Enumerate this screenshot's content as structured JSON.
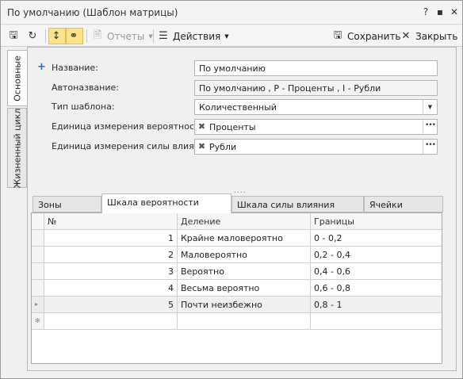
{
  "window": {
    "title": "По умолчанию (Шаблон матрицы)",
    "help_glyph": "?",
    "restore_glyph": "▪",
    "close_glyph": "✕"
  },
  "toolbar": {
    "reports_label": "Отчеты",
    "actions_label": "Действия",
    "save_label": "Сохранить",
    "close_label": "Закрыть",
    "icons": {
      "save": "🖫",
      "refresh": "↻",
      "sort": "↕",
      "link": "⚭",
      "reports": "🗎",
      "actions": "☰",
      "close": "✕"
    }
  },
  "side_tabs": {
    "main": "Основные",
    "lifecycle": "Жизненный цикл"
  },
  "form": {
    "name_label": "Название:",
    "name_value": "По умолчанию",
    "autoname_label": "Автоназвание:",
    "autoname_value": "По умолчанию , P - Проценты , I - Рубли",
    "template_type_label": "Тип шаблона:",
    "template_type_value": "Количественный",
    "prob_unit_label": "Единица измерения вероятности:",
    "prob_unit_value": "Проценты",
    "impact_unit_label": "Единица измерения силы влияния:",
    "impact_unit_value": "Рубли"
  },
  "splitter_glyph": "....",
  "tabs": {
    "zones": "Зоны",
    "prob_scale": "Шкала вероятности",
    "impact_scale": "Шкала силы влияния",
    "cells": "Ячейки"
  },
  "grid": {
    "columns": {
      "num": "№",
      "name": "Деление",
      "range": "Границы"
    },
    "rows": [
      {
        "num": "1",
        "name": "Крайне маловероятно",
        "range": "0 - 0,2"
      },
      {
        "num": "2",
        "name": "Маловероятно",
        "range": "0,2 - 0,4"
      },
      {
        "num": "3",
        "name": "Вероятно",
        "range": "0,4 - 0,6"
      },
      {
        "num": "4",
        "name": "Весьма вероятно",
        "range": "0,6 - 0,8"
      },
      {
        "num": "5",
        "name": "Почти неизбежно",
        "range": "0,8 - 1"
      }
    ],
    "current_row_marker": "▸",
    "new_row_marker": "✻"
  },
  "colors": {
    "accent_blue": "#2a66c6",
    "active_button": "#fbe38a"
  }
}
